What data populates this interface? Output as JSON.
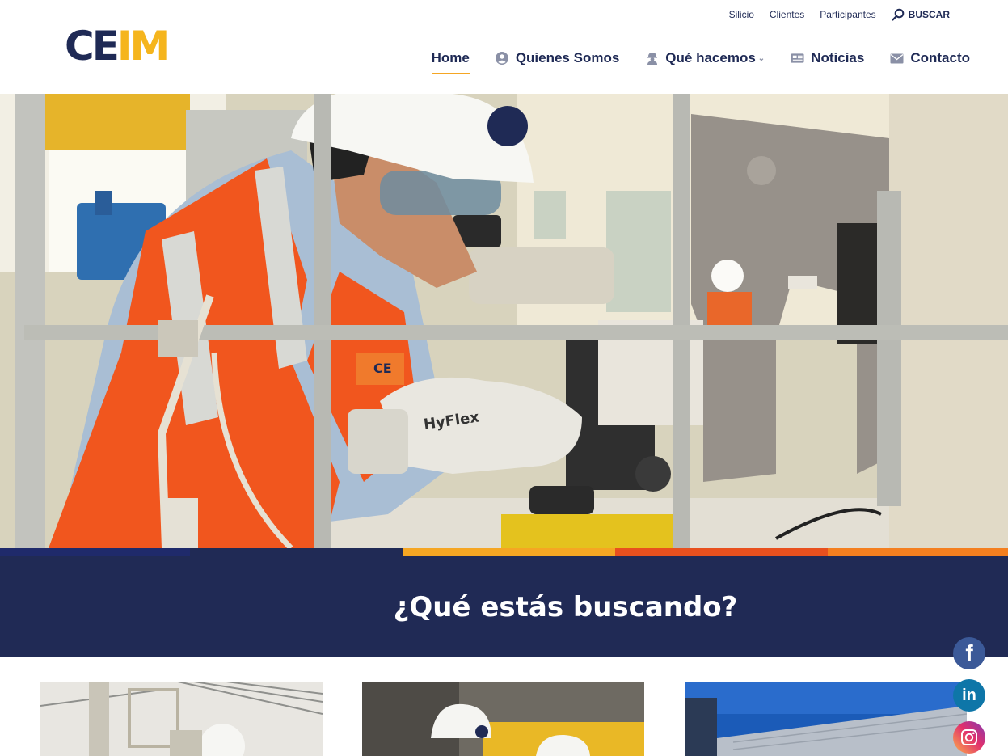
{
  "brand": {
    "logo_part1": "CE",
    "logo_part2": "IM"
  },
  "topbar": {
    "links": [
      "Silicio",
      "Clientes",
      "Participantes"
    ],
    "search_label": "BUSCAR"
  },
  "nav": {
    "items": [
      {
        "label": "Home",
        "icon": "none",
        "active": true
      },
      {
        "label": "Quienes Somos",
        "icon": "user-circle-icon"
      },
      {
        "label": "Qué hacemos",
        "icon": "worker-icon",
        "dropdown": true
      },
      {
        "label": "Noticias",
        "icon": "newspaper-icon"
      },
      {
        "label": "Contacto",
        "icon": "envelope-icon"
      }
    ]
  },
  "hero": {
    "vest_logo": "CE",
    "glove_brand": "HyFlex"
  },
  "stripe_colors": [
    "#1f2a6b",
    "#202a55",
    "#f5a623",
    "#e8501e",
    "#f47f1f"
  ],
  "band": {
    "heading": "¿Qué estás buscando?"
  },
  "social": {
    "facebook": "f",
    "linkedin": "in",
    "instagram": "instagram-icon"
  },
  "colors": {
    "navy": "#202a55",
    "accent": "#f5b51d",
    "orange": "#f47f1f"
  }
}
